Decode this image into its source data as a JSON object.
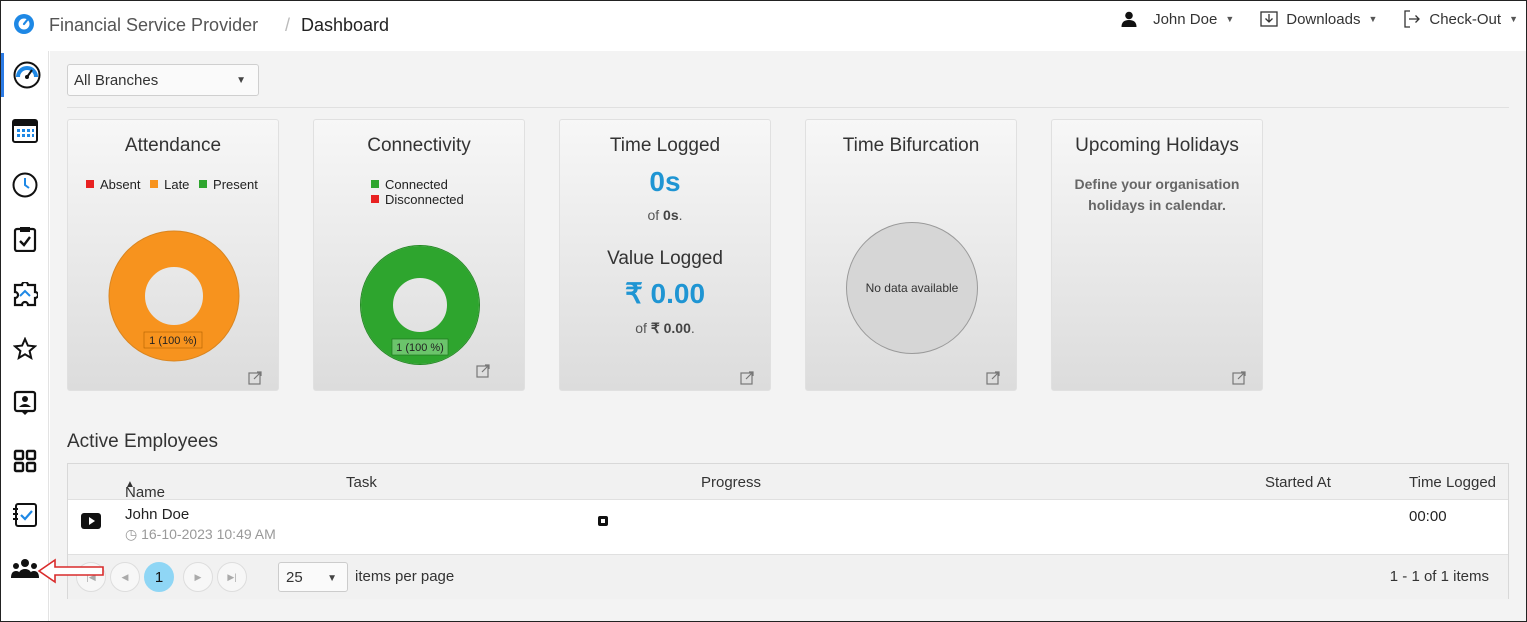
{
  "header": {
    "app_name": "Financial Service Provider",
    "separator": "/",
    "page_title": "Dashboard",
    "user_label": "John Doe",
    "downloads_label": "Downloads",
    "checkout_label": "Check-Out"
  },
  "sidebar": {
    "items": [
      "dashboard-icon",
      "calendar-icon",
      "clock-icon",
      "task-check-icon",
      "puzzle-icon",
      "star-icon",
      "badge-icon",
      "apps-grid-icon",
      "checklist-icon",
      "team-icon"
    ]
  },
  "filters": {
    "branch_value": "All Branches"
  },
  "cards": {
    "attendance": {
      "title": "Attendance",
      "legend": [
        {
          "label": "Absent",
          "color": "#e82121"
        },
        {
          "label": "Late",
          "color": "#f7931e"
        },
        {
          "label": "Present",
          "color": "#2ea52e"
        }
      ],
      "slice_label": "1 (100 %)",
      "slices": [
        {
          "name": "Late",
          "value": 1,
          "percent": 100
        }
      ]
    },
    "connectivity": {
      "title": "Connectivity",
      "legend": [
        {
          "label": "Connected",
          "color": "#2ea52e"
        },
        {
          "label": "Disconnected",
          "color": "#e82121"
        }
      ],
      "slice_label": "1 (100 %)",
      "slices": [
        {
          "name": "Connected",
          "value": 1,
          "percent": 100
        }
      ]
    },
    "time_logged": {
      "title": "Time Logged",
      "value": "0s",
      "of_prefix": "of ",
      "of_value": "0s",
      "of_suffix": ".",
      "value_title": "Value Logged",
      "value_amount": "₹ 0.00",
      "value_of_prefix": "of ",
      "value_of_value": "₹ 0.00",
      "value_of_suffix": "."
    },
    "time_bifurcation": {
      "title": "Time Bifurcation",
      "empty_text": "No data available"
    },
    "holidays": {
      "title": "Upcoming Holidays",
      "message_line1": "Define your organisation",
      "message_line2": "holidays in calendar."
    }
  },
  "active_employees": {
    "title": "Active Employees",
    "columns": {
      "name": "Name",
      "sort_indicator": "▲",
      "task": "Task",
      "progress": "Progress",
      "started_at": "Started At",
      "time_logged": "Time Logged"
    },
    "rows": [
      {
        "name": "John Doe",
        "timestamp": "16-10-2023 10:49 AM",
        "task": "",
        "started_at": "",
        "time_logged": "00:00"
      }
    ],
    "pager": {
      "current_page": "1",
      "page_size": "25",
      "per_page_label": "items per page",
      "summary": "1 - 1 of 1 items"
    }
  },
  "colors": {
    "accent": "#1f95d3",
    "late": "#f7931e",
    "present": "#2ea52e",
    "absent": "#e82121",
    "annotation_arrow": "#d92b2b"
  }
}
